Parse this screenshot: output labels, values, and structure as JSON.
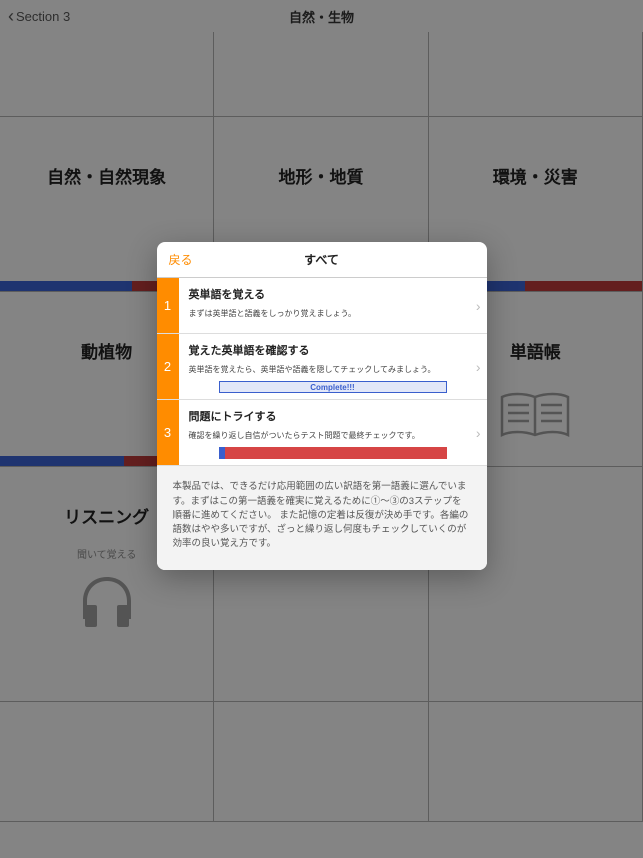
{
  "header": {
    "back_label": "Section 3",
    "title": "自然・生物"
  },
  "grid": {
    "cells": [
      {
        "title": "自然・自然現象"
      },
      {
        "title": "地形・地質"
      },
      {
        "title": "環境・災害"
      },
      {
        "title": "動植物"
      },
      {
        "title": ""
      },
      {
        "title": "単語帳"
      },
      {
        "title": "リスニング",
        "sub": "聞いて覚える"
      }
    ]
  },
  "modal": {
    "back_label": "戻る",
    "title": "すべて",
    "steps": [
      {
        "num": "1",
        "title": "英単語を覚える",
        "desc": "まずは英単語と語義をしっかり覚えましょう。"
      },
      {
        "num": "2",
        "title": "覚えた英単語を確認する",
        "desc": "英単語を覚えたら、英単語や語義を隠してチェックしてみましょう。",
        "complete_label": "Complete!!!"
      },
      {
        "num": "3",
        "title": "問題にトライする",
        "desc": "確認を繰り返し自信がついたらテスト問題で最終チェックです。"
      }
    ],
    "footer": "本製品では、できるだけ応用範囲の広い訳語を第一語義に選んでいます。まずはこの第一語義を確実に覚えるために①〜③の3ステップを順番に進めてください。\nまた記憶の定着は反復が決め手です。各編の語数はやや多いですが、ざっと繰り返し何度もチェックしていくのが効率の良い覚え方です。"
  }
}
